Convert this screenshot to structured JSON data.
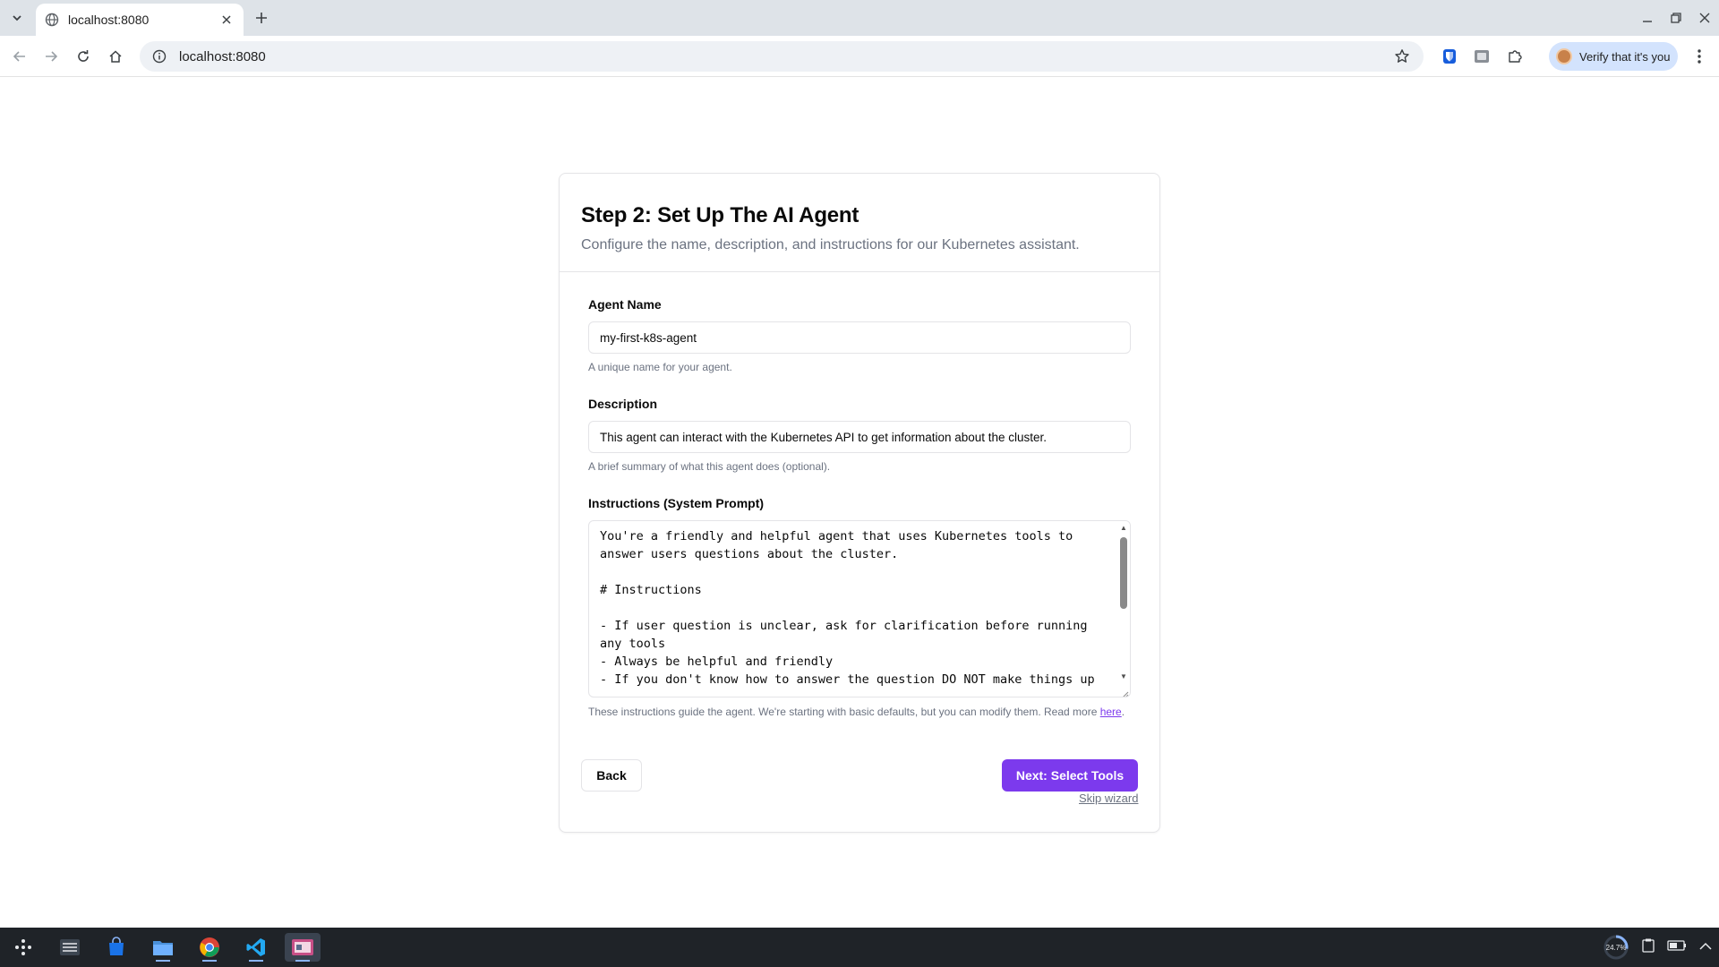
{
  "browser": {
    "tab_title": "localhost:8080",
    "url": "localhost:8080",
    "profile_label": "Verify that it's you"
  },
  "page": {
    "title": "Step 2: Set Up The AI Agent",
    "description": "Configure the name, description, and instructions for our Kubernetes assistant.",
    "agent_name": {
      "label": "Agent Name",
      "value": "my-first-k8s-agent",
      "hint": "A unique name for your agent."
    },
    "description_field": {
      "label": "Description",
      "value": "This agent can interact with the Kubernetes API to get information about the cluster.",
      "hint": "A brief summary of what this agent does (optional)."
    },
    "instructions": {
      "label": "Instructions (System Prompt)",
      "value": "You're a friendly and helpful agent that uses Kubernetes tools to answer users questions about the cluster.\n\n# Instructions\n\n- If user question is unclear, ask for clarification before running any tools\n- Always be helpful and friendly\n- If you don't know how to answer the question DO NOT make things up",
      "hint_prefix": "These instructions guide the agent. We're starting with basic defaults, but you can modify them. Read more ",
      "hint_link": "here",
      "hint_suffix": "."
    },
    "back_label": "Back",
    "next_label": "Next: Select Tools",
    "skip_label": "Skip wizard"
  },
  "taskbar": {
    "cpu_percent": "24.7%"
  },
  "colors": {
    "accent": "#7c3aed",
    "tab_strip": "#dee3e8",
    "taskbar": "#1f2328"
  },
  "icons": [
    "tab-search-icon",
    "globe-icon",
    "close-icon",
    "plus-icon",
    "minimize-icon",
    "restore-icon",
    "back-icon",
    "forward-icon",
    "reload-icon",
    "home-icon",
    "site-info-icon",
    "star-icon",
    "bitwarden-icon",
    "extension-icon",
    "puzzle-icon",
    "kebab-menu-icon"
  ]
}
